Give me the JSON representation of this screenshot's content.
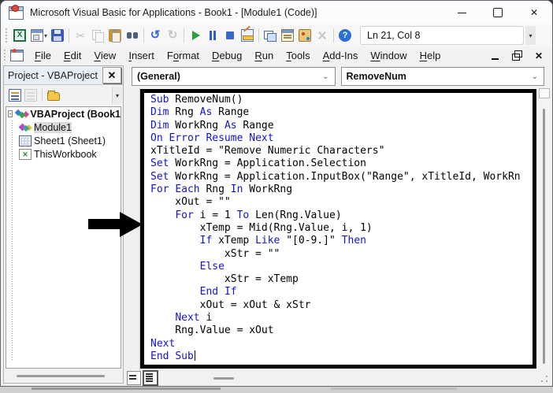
{
  "window": {
    "title": "Microsoft Visual Basic for Applications - Book1 - [Module1 (Code)]"
  },
  "toolbar": {
    "items": [
      {
        "name": "excel-icon"
      },
      {
        "name": "insert-userform-icon",
        "dropdown": true
      },
      {
        "name": "save-icon"
      },
      {
        "sep": true
      },
      {
        "name": "cut-icon",
        "disabled": true
      },
      {
        "name": "copy-icon",
        "disabled": true
      },
      {
        "name": "paste-icon"
      },
      {
        "name": "find-icon"
      },
      {
        "sep": true
      },
      {
        "name": "undo-icon"
      },
      {
        "name": "redo-icon",
        "disabled": true
      },
      {
        "sep": true
      },
      {
        "name": "run-icon"
      },
      {
        "name": "break-icon"
      },
      {
        "name": "reset-icon"
      },
      {
        "name": "design-mode-icon"
      },
      {
        "sep": true
      },
      {
        "name": "project-explorer-icon"
      },
      {
        "name": "properties-window-icon"
      },
      {
        "name": "object-browser-icon"
      },
      {
        "name": "toolbox-icon",
        "disabled": true
      },
      {
        "sep": true
      },
      {
        "name": "help-icon"
      }
    ],
    "line_col": "Ln 21, Col 8"
  },
  "menubar": {
    "items": [
      {
        "pre": "",
        "key": "F",
        "post": "ile"
      },
      {
        "pre": "",
        "key": "E",
        "post": "dit"
      },
      {
        "pre": "",
        "key": "V",
        "post": "iew"
      },
      {
        "pre": "",
        "key": "I",
        "post": "nsert"
      },
      {
        "pre": "F",
        "key": "o",
        "post": "rmat"
      },
      {
        "pre": "",
        "key": "D",
        "post": "ebug"
      },
      {
        "pre": "",
        "key": "R",
        "post": "un"
      },
      {
        "pre": "",
        "key": "T",
        "post": "ools"
      },
      {
        "pre": "",
        "key": "A",
        "post": "dd-Ins"
      },
      {
        "pre": "",
        "key": "W",
        "post": "indow"
      },
      {
        "pre": "",
        "key": "H",
        "post": "elp"
      }
    ]
  },
  "project_panel": {
    "title": "Project - VBAProject",
    "tree": [
      {
        "label": "VBAProject (Book1",
        "icon": "project-icon",
        "bold": true,
        "expander": "-",
        "indent": 0
      },
      {
        "label": "Module1",
        "icon": "module-icon",
        "selected": true,
        "indent": 1
      },
      {
        "label": "Sheet1 (Sheet1)",
        "icon": "sheet-icon",
        "indent": 1
      },
      {
        "label": "ThisWorkbook",
        "icon": "workbook-icon",
        "indent": 1
      }
    ]
  },
  "code_pane": {
    "left_dropdown": "(General)",
    "right_dropdown": "RemoveNum",
    "keyword_color": "#1414cc",
    "keywords": [
      "Sub",
      "Dim",
      "As",
      "On",
      "Error",
      "Resume",
      "Next",
      "Set",
      "For",
      "Each",
      "In",
      "To",
      "If",
      "Like",
      "Then",
      "Else",
      "End"
    ],
    "code_lines": [
      "Sub RemoveNum()",
      "Dim Rng As Range",
      "Dim WorkRng As Range",
      "On Error Resume Next",
      "xTitleId = \"Remove Numeric Characters\"",
      "Set WorkRng = Application.Selection",
      "Set WorkRng = Application.InputBox(\"Range\", xTitleId, WorkRn",
      "For Each Rng In WorkRng",
      "    xOut = \"\"",
      "    For i = 1 To Len(Rng.Value)",
      "        xTemp = Mid(Rng.Value, i, 1)",
      "        If xTemp Like \"[0-9.]\" Then",
      "            xStr = \"\"",
      "        Else",
      "            xStr = xTemp",
      "        End If",
      "        xOut = xOut & xStr",
      "    Next i",
      "    Rng.Value = xOut",
      "Next",
      "End Sub"
    ]
  }
}
